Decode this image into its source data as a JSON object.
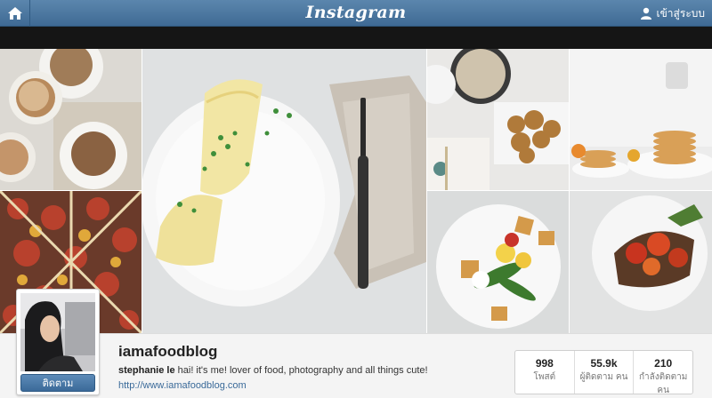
{
  "header": {
    "title": "Instagram",
    "login_label": "เข้าสู่ระบบ"
  },
  "profile": {
    "username": "iamafoodblog",
    "bio_name": "stephanie le",
    "bio_text": " hai!  it's me! lover of food, photography and all things cute!",
    "website": "http://www.iamafoodblog.com",
    "follow_label": "ติดตาม"
  },
  "stats": [
    {
      "value": "998",
      "label": "โพสต์"
    },
    {
      "value": "55.9k",
      "label": "ผู้ติดตาม คน"
    },
    {
      "value": "210",
      "label": "กำลังติดตาม คน"
    }
  ],
  "icons": {
    "home": "home-icon",
    "user": "user-icon"
  }
}
